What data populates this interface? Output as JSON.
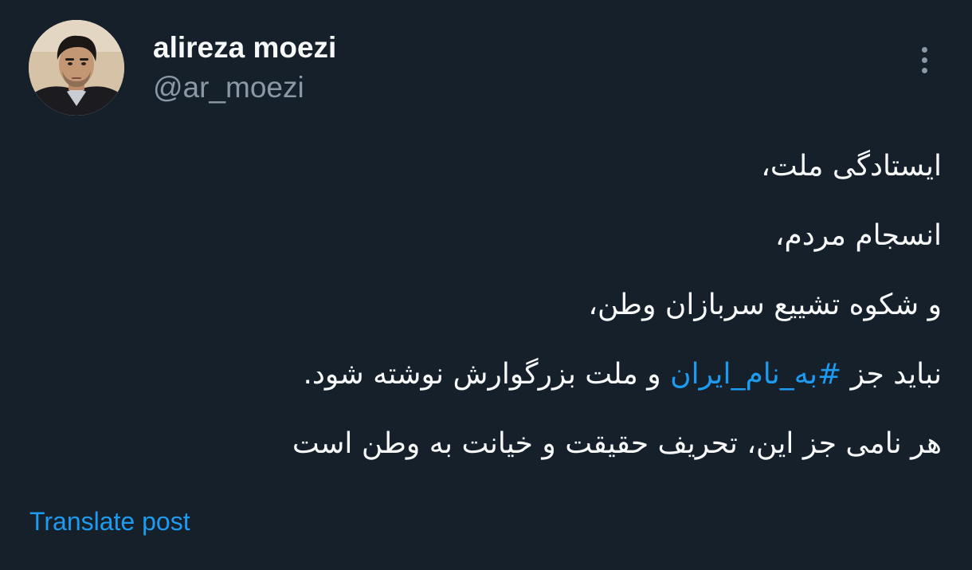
{
  "author": {
    "display_name": "alireza moezi",
    "handle": "@ar_moezi"
  },
  "menu": {
    "icon": "more-vertical-icon"
  },
  "post": {
    "line1": "ایستادگی ملت،",
    "line2": "انسجام مردم،",
    "line3": "و شکوه تشییع سربازان وطن،",
    "line4_before": "نباید جز",
    "line4_hashtag": "#به_نام_ایران",
    "line4_after": "و ملت بزرگوارش نوشته شود.",
    "line5": "هر نامی جز این، تحریف حقیقت و خیانت به وطن است"
  },
  "translate": {
    "label": "Translate post"
  },
  "colors": {
    "background": "#15202b",
    "primary_text": "#f7f9f9",
    "secondary_text": "#8b98a5",
    "link": "#1d9bf0"
  }
}
